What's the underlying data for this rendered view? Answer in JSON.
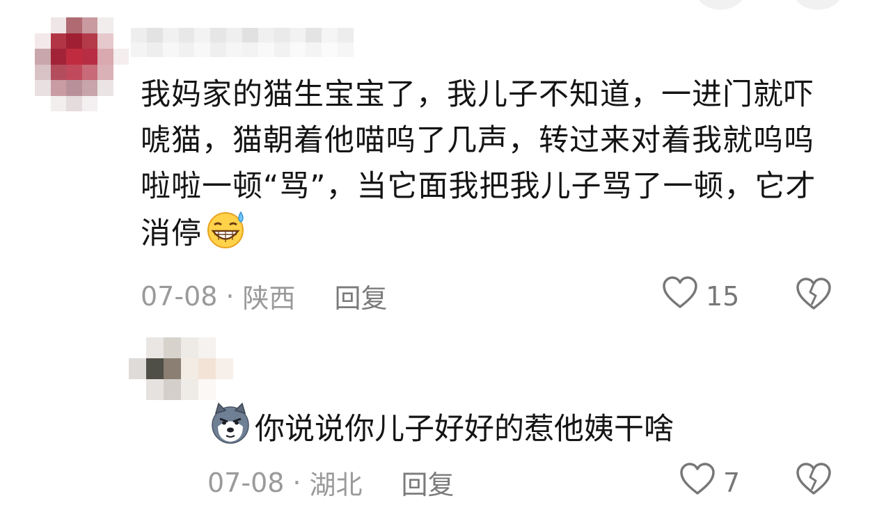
{
  "comments": [
    {
      "text": "我妈家的猫生宝宝了，我儿子不知道，一进门就吓唬猫，猫朝着他喵呜了几声，转过来对着我就呜呜啦啦一顿“骂”，当它面我把我儿子骂了一顿，它才消停",
      "emoji": "grinning-sweat-emoji",
      "date": "07-08",
      "separator": "·",
      "location": "陕西",
      "reply_label": "回复",
      "likes": "15"
    },
    {
      "text": "你说说你儿子好好的惹他姨干啥",
      "emoji": "husky-dog-emoji",
      "date": "07-08",
      "separator": "·",
      "location": "湖北",
      "reply_label": "回复",
      "likes": "7"
    }
  ],
  "icons": {
    "like": "heart-outline-icon",
    "dislike": "broken-heart-icon"
  },
  "colors": {
    "text": "#141414",
    "meta": "#9a9a9a",
    "icon": "#777777"
  }
}
